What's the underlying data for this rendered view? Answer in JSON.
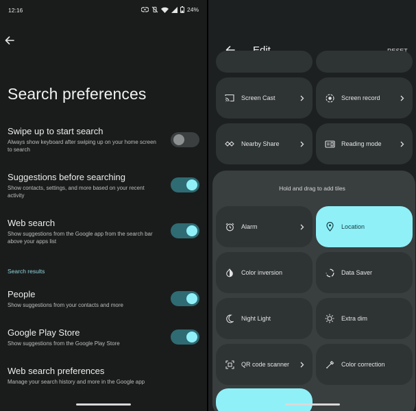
{
  "left": {
    "status": {
      "time": "12:16",
      "battery": "24%"
    },
    "title": "Search preferences",
    "prefs": [
      {
        "title": "Swipe up to start search",
        "subtitle": "Always show keyboard after swiping up on your home screen to search",
        "enabled": false
      },
      {
        "title": "Suggestions before searching",
        "subtitle": "Show contacts, settings, and more based on your recent activity",
        "enabled": true
      },
      {
        "title": "Web search",
        "subtitle": "Show suggestions from the Google app from the search bar above your apps list",
        "enabled": true
      }
    ],
    "section_label": "Search results",
    "results": [
      {
        "title": "People",
        "subtitle": "Show suggestions from your contacts and more",
        "enabled": true
      },
      {
        "title": "Google Play Store",
        "subtitle": "Show suggestions from the Google Play Store",
        "enabled": true
      }
    ],
    "web_prefs": {
      "title": "Web search preferences",
      "subtitle": "Manage your search history and more in the Google app"
    }
  },
  "right": {
    "title": "Edit",
    "reset_label": "RESET",
    "top_tiles": [
      {
        "label": "Screen Cast",
        "icon": "cast-icon"
      },
      {
        "label": "Screen record",
        "icon": "record-icon"
      },
      {
        "label": "Nearby Share",
        "icon": "nearby-share-icon"
      },
      {
        "label": "Reading mode",
        "icon": "reading-mode-icon"
      }
    ],
    "hold_text": "Hold and drag to add tiles",
    "add_tiles": [
      {
        "label": "Alarm",
        "icon": "alarm-icon"
      },
      {
        "label": "Location",
        "icon": "location-icon",
        "active": true
      },
      {
        "label": "Color inversion",
        "icon": "color-inversion-icon"
      },
      {
        "label": "Data Saver",
        "icon": "data-saver-icon"
      },
      {
        "label": "Night Light",
        "icon": "night-light-icon"
      },
      {
        "label": "Extra dim",
        "icon": "extra-dim-icon"
      },
      {
        "label": "QR code scanner",
        "icon": "qr-code-icon"
      },
      {
        "label": "Color correction",
        "icon": "color-correction-icon"
      }
    ]
  },
  "colors": {
    "accent": "#8ff0f8",
    "toggle_on_track": "#2f6b72",
    "section_label": "#8fd4dc",
    "left_bg": "#1a1c1c",
    "right_bg": "#1d2021",
    "tile_bg": "#2e3334"
  }
}
